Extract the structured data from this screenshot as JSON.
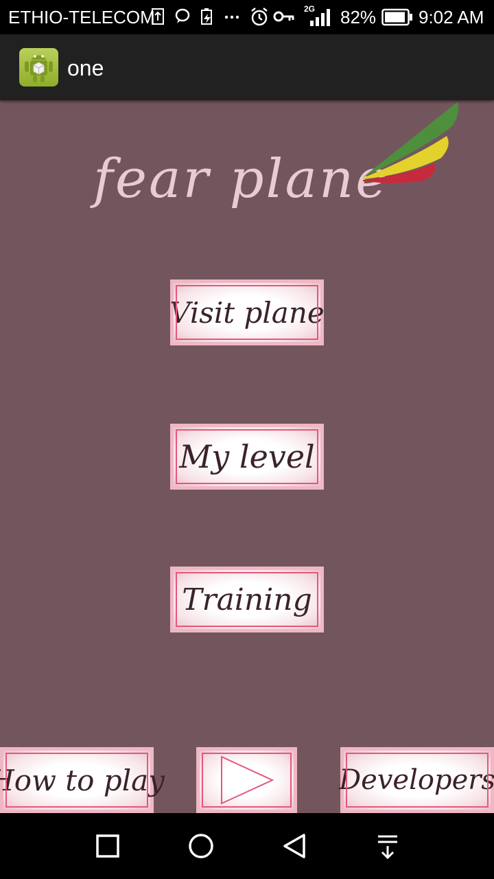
{
  "status_bar": {
    "carrier": "ETHIO-TELECOM",
    "network_type": "2G",
    "battery_percent": "82%",
    "time": "9:02 AM",
    "icons": [
      "upload-icon",
      "chat-icon",
      "battery-saver-icon",
      "more-dots-icon",
      "alarm-icon",
      "key-icon",
      "signal-icon",
      "battery-icon"
    ]
  },
  "app_bar": {
    "icon": "android-app-icon",
    "title": "one"
  },
  "logo": {
    "text": "fear plane",
    "wing_colors": [
      "#4d8f3c",
      "#e4d22c",
      "#c72a3c"
    ]
  },
  "menu": {
    "visit_plane": "Visit plane",
    "my_level": "My level",
    "training": "Training"
  },
  "bottom": {
    "how_to_play": "How to play",
    "play_icon": "play-icon",
    "developers": "Developers"
  },
  "nav_bar": {
    "icons": [
      "recent-apps-icon",
      "home-icon",
      "back-icon",
      "notifications-pull-icon"
    ]
  },
  "colors": {
    "background": "#73565d",
    "button_border": "#e5577b",
    "text_dark": "#3b2328",
    "logo_text": "#e8cbd3"
  }
}
